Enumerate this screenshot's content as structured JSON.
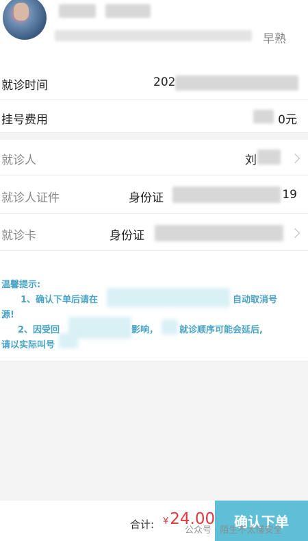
{
  "header": {
    "doctor_suffix": "早熟"
  },
  "rows": {
    "visit_time": {
      "label": "就诊时间",
      "value": "202"
    },
    "fee": {
      "label": "挂号费用",
      "value": "0元"
    },
    "patient": {
      "label": "就诊人",
      "value": "刘"
    },
    "patient_id": {
      "label": "就诊人证件",
      "id_type": "身份证",
      "id_tail": "19"
    },
    "card": {
      "label": "就诊卡",
      "card_type": "身份证"
    }
  },
  "tips": {
    "title": "温馨提示:",
    "line1_start": "1、确认下单后请在",
    "line1_end": "自动取消号",
    "line2": "源!",
    "line3_start": "2、因受回",
    "line3_mid": "影响，",
    "line3_end": "就诊顺序可能会延后,",
    "line4": "请以实际叫号"
  },
  "footer": {
    "total_label": "合计:",
    "currency": "¥",
    "total_amount": "24.00",
    "confirm_label": "确认下单",
    "watermark": "公众号 · 陌生不太懂安全"
  },
  "colors": {
    "accent": "#5fbfd6",
    "price": "#e4393c",
    "tip_text": "#4aa3c4"
  }
}
